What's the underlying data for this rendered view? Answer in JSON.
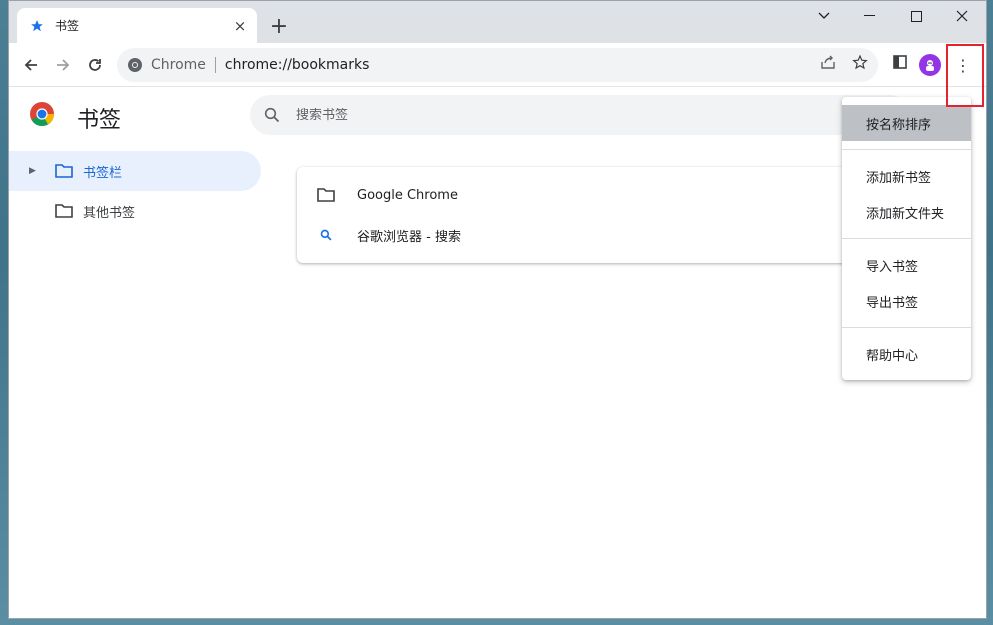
{
  "tab": {
    "title": "书签",
    "close_glyph": "×",
    "new_tab_glyph": "+"
  },
  "window_controls": {
    "dropdown": "chevron-down-icon",
    "minimize": "minimize-icon",
    "maximize": "maximize-icon",
    "close": "close-icon"
  },
  "toolbar": {
    "site_label": "Chrome",
    "url": "chrome://bookmarks",
    "menu_glyph": "⋮"
  },
  "bookmarks": {
    "title": "书签",
    "search_placeholder": "搜索书签",
    "sidebar": [
      {
        "label": "书签栏",
        "selected": true
      },
      {
        "label": "其他书签",
        "selected": false
      }
    ],
    "items": [
      {
        "type": "folder",
        "label": "Google Chrome"
      },
      {
        "type": "search",
        "label": "谷歌浏览器 - 搜索"
      }
    ]
  },
  "menu": {
    "items": [
      {
        "label": "按名称排序"
      },
      {
        "label": "添加新书签"
      },
      {
        "label": "添加新文件夹"
      },
      {
        "label": "导入书签"
      },
      {
        "label": "导出书签"
      },
      {
        "label": "帮助中心"
      }
    ]
  },
  "colors": {
    "accent": "#1a73e8",
    "selected_bg": "#e8f0fe",
    "highlight": "#e4232f"
  }
}
